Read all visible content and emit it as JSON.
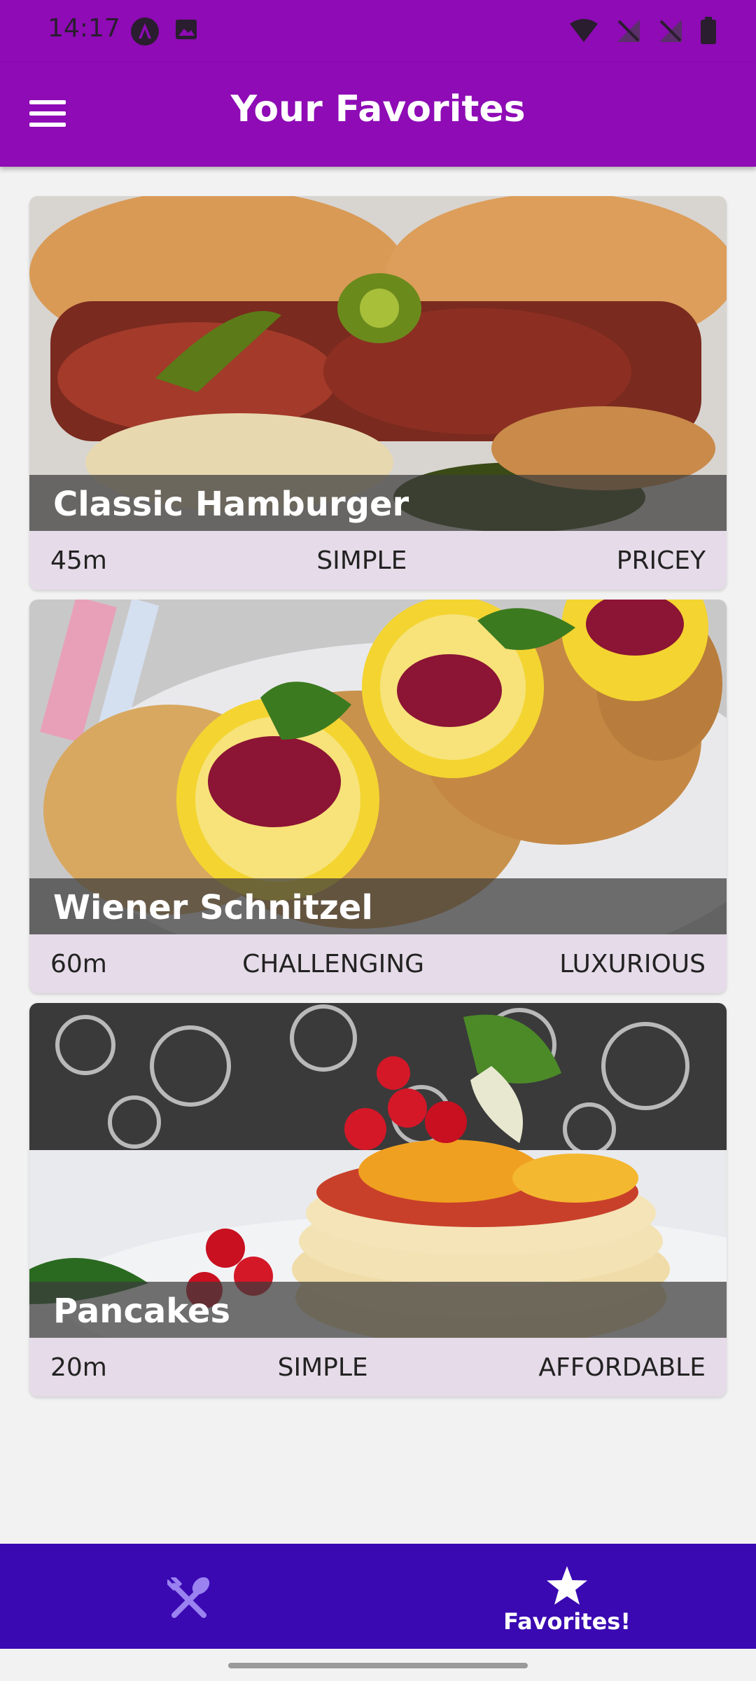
{
  "status_bar": {
    "time": "14:17",
    "left_icons": [
      "angular-icon",
      "image-icon"
    ],
    "right_icons": [
      "wifi-icon",
      "no-signal-icon",
      "no-signal-icon",
      "battery-icon"
    ]
  },
  "app_bar": {
    "title": "Your Favorites",
    "menu_icon": "hamburger-menu-icon"
  },
  "meals": [
    {
      "title": "Classic Hamburger",
      "duration": "45m",
      "complexity": "SIMPLE",
      "affordability": "PRICEY"
    },
    {
      "title": "Wiener Schnitzel",
      "duration": "60m",
      "complexity": "CHALLENGING",
      "affordability": "LUXURIOUS"
    },
    {
      "title": "Pancakes",
      "duration": "20m",
      "complexity": "SIMPLE",
      "affordability": "AFFORDABLE"
    }
  ],
  "bottom_nav": {
    "items": [
      {
        "label": "",
        "icon": "fork-knife-icon",
        "active": false
      },
      {
        "label": "Favorites!",
        "icon": "star-icon",
        "active": true
      }
    ]
  },
  "colors": {
    "primary": "#8e0bb5",
    "nav_background": "#3a09b2",
    "card_footer": "#e6dbe8",
    "inactive_icon": "#9a82f0"
  }
}
